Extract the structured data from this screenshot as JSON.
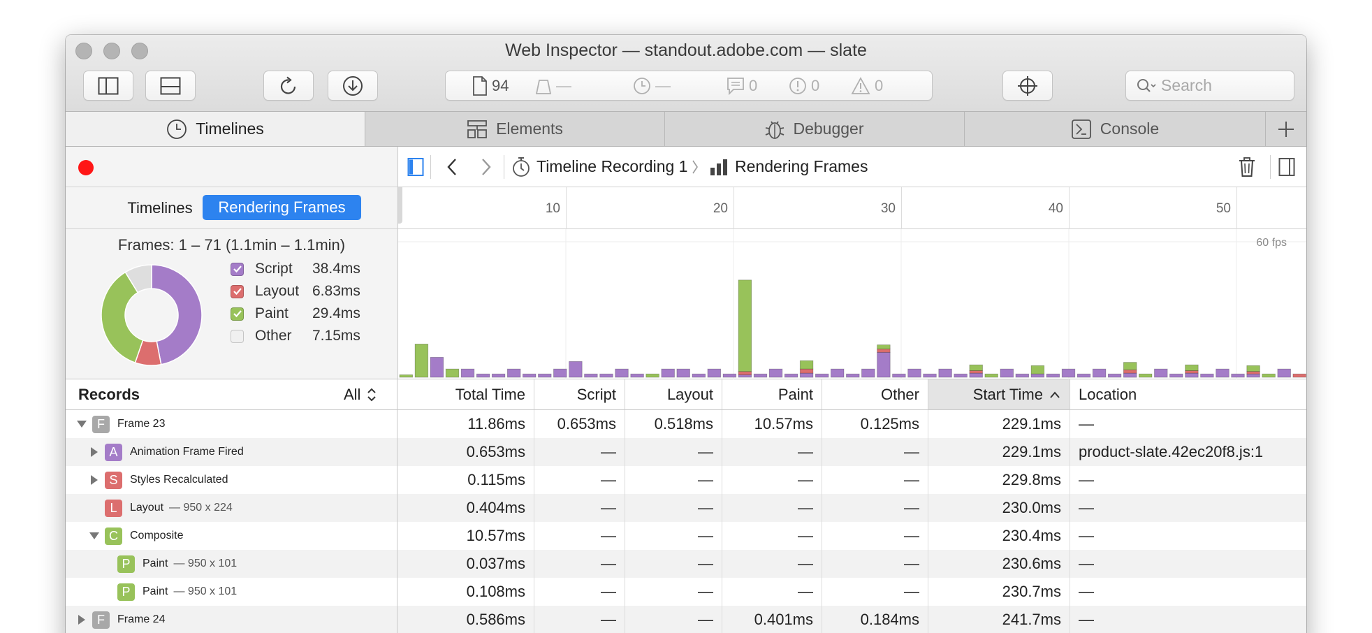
{
  "window": {
    "title": "Web Inspector — standout.adobe.com — slate"
  },
  "toolbar": {
    "resource_count": "94",
    "requests_count": "—",
    "load_time": "—",
    "logs_count": "0",
    "errors_count": "0",
    "warnings_count": "0",
    "search_placeholder": "Search"
  },
  "tabs": [
    {
      "label": "Timelines",
      "icon": "clock-icon",
      "active": true
    },
    {
      "label": "Elements",
      "icon": "elements-icon",
      "active": false
    },
    {
      "label": "Debugger",
      "icon": "bug-icon",
      "active": false
    },
    {
      "label": "Console",
      "icon": "console-icon",
      "active": false
    }
  ],
  "sidebar": {
    "mode_timelines": "Timelines",
    "mode_frames": "Rendering Frames",
    "frames_range": "Frames: 1 – 71 (1.1min – 1.1min)",
    "legend": [
      {
        "label": "Script",
        "value": "38.4ms",
        "color": "#a47cc8",
        "checked": true
      },
      {
        "label": "Layout",
        "value": "6.83ms",
        "color": "#dc6e6e",
        "checked": true
      },
      {
        "label": "Paint",
        "value": "29.4ms",
        "color": "#98c25a",
        "checked": true
      },
      {
        "label": "Other",
        "value": "7.15ms",
        "color": "#dedede",
        "checked": false
      }
    ]
  },
  "navbar": {
    "recording": "Timeline Recording 1",
    "view": "Rendering Frames"
  },
  "ruler": {
    "ticks": [
      "10",
      "20",
      "30",
      "40",
      "50"
    ],
    "fps_label": "60 fps"
  },
  "frames": [
    [
      0,
      0,
      0.3,
      0
    ],
    [
      0,
      0,
      4.0,
      0
    ],
    [
      2.4,
      0,
      0,
      0
    ],
    [
      0,
      0,
      1.0,
      0
    ],
    [
      1.0,
      0,
      0,
      0
    ],
    [
      0.4,
      0,
      0,
      0
    ],
    [
      0.4,
      0,
      0,
      0
    ],
    [
      1.0,
      0,
      0,
      0
    ],
    [
      0.4,
      0,
      0,
      0
    ],
    [
      0.4,
      0,
      0,
      0
    ],
    [
      1.0,
      0,
      0,
      0
    ],
    [
      1.9,
      0,
      0,
      0
    ],
    [
      0.4,
      0,
      0,
      0
    ],
    [
      0.4,
      0,
      0,
      0
    ],
    [
      1.0,
      0,
      0,
      0
    ],
    [
      0.4,
      0,
      0,
      0
    ],
    [
      0,
      0,
      0.4,
      0
    ],
    [
      1.0,
      0,
      0,
      0
    ],
    [
      1.0,
      0,
      0,
      0
    ],
    [
      0.4,
      0,
      0,
      0
    ],
    [
      1.0,
      0,
      0,
      0
    ],
    [
      0.4,
      0,
      0,
      0
    ],
    [
      0.3,
      0.4,
      11.0,
      0
    ],
    [
      0.4,
      0,
      0,
      0
    ],
    [
      1.0,
      0,
      0,
      0
    ],
    [
      0.4,
      0,
      0,
      0
    ],
    [
      0.5,
      0.5,
      1.0,
      0
    ],
    [
      0.4,
      0,
      0,
      0
    ],
    [
      1.0,
      0,
      0,
      0
    ],
    [
      0.4,
      0,
      0,
      0
    ],
    [
      1.0,
      0,
      0,
      0
    ],
    [
      3.0,
      0.4,
      0.5,
      0
    ],
    [
      0.4,
      0,
      0,
      0
    ],
    [
      1.0,
      0,
      0,
      0
    ],
    [
      0.4,
      0,
      0,
      0
    ],
    [
      1.0,
      0,
      0,
      0
    ],
    [
      0.4,
      0,
      0,
      0
    ],
    [
      0.5,
      0.3,
      0.7,
      0
    ],
    [
      0,
      0,
      0.4,
      0
    ],
    [
      1.0,
      0,
      0,
      0
    ],
    [
      0.4,
      0,
      0,
      0
    ],
    [
      0.4,
      0,
      1.0,
      0
    ],
    [
      0.4,
      0,
      0,
      0
    ],
    [
      1.0,
      0,
      0,
      0
    ],
    [
      0.4,
      0,
      0,
      0
    ],
    [
      1.0,
      0,
      0,
      0
    ],
    [
      0.4,
      0,
      0,
      0
    ],
    [
      0.5,
      0.4,
      0.9,
      0
    ],
    [
      0,
      0,
      0.4,
      0
    ],
    [
      1.0,
      0,
      0,
      0
    ],
    [
      0.4,
      0,
      0,
      0
    ],
    [
      0.5,
      0.3,
      0.7,
      0
    ],
    [
      0.4,
      0,
      0,
      0
    ],
    [
      1.0,
      0,
      0,
      0
    ],
    [
      0.4,
      0,
      0,
      0
    ],
    [
      0.4,
      0.3,
      0.7,
      0
    ],
    [
      0,
      0,
      0.4,
      0
    ],
    [
      1.0,
      0,
      0,
      0
    ],
    [
      0,
      0.4,
      0,
      0
    ]
  ],
  "table": {
    "records_label": "Records",
    "filter_label": "All",
    "columns": {
      "total": "Total Time",
      "script": "Script",
      "layout": "Layout",
      "paint": "Paint",
      "other": "Other",
      "start": "Start Time",
      "location": "Location"
    },
    "rows": [
      {
        "indent": 0,
        "disclosure": "open",
        "badge": "F",
        "color": "#a8a8a8",
        "name": "Frame 23",
        "sub": "",
        "total": "11.86ms",
        "script": "0.653ms",
        "layout": "0.518ms",
        "paint": "10.57ms",
        "other": "0.125ms",
        "start": "229.1ms",
        "location": "—"
      },
      {
        "indent": 1,
        "disclosure": "closed",
        "badge": "A",
        "color": "#a47cc8",
        "name": "Animation Frame Fired",
        "sub": "",
        "total": "0.653ms",
        "script": "—",
        "layout": "—",
        "paint": "—",
        "other": "—",
        "start": "229.1ms",
        "location": "product-slate.42ec20f8.js:1"
      },
      {
        "indent": 1,
        "disclosure": "closed",
        "badge": "S",
        "color": "#dc6e6e",
        "name": "Styles Recalculated",
        "sub": "",
        "total": "0.115ms",
        "script": "—",
        "layout": "—",
        "paint": "—",
        "other": "—",
        "start": "229.8ms",
        "location": "—"
      },
      {
        "indent": 1,
        "disclosure": "none",
        "badge": "L",
        "color": "#dc6e6e",
        "name": "Layout",
        "sub": "— 950 x 224",
        "total": "0.404ms",
        "script": "—",
        "layout": "—",
        "paint": "—",
        "other": "—",
        "start": "230.0ms",
        "location": "—"
      },
      {
        "indent": 1,
        "disclosure": "open",
        "badge": "C",
        "color": "#98c25a",
        "name": "Composite",
        "sub": "",
        "total": "10.57ms",
        "script": "—",
        "layout": "—",
        "paint": "—",
        "other": "—",
        "start": "230.4ms",
        "location": "—"
      },
      {
        "indent": 2,
        "disclosure": "none",
        "badge": "P",
        "color": "#98c25a",
        "name": "Paint",
        "sub": "— 950 x 101",
        "total": "0.037ms",
        "script": "—",
        "layout": "—",
        "paint": "—",
        "other": "—",
        "start": "230.6ms",
        "location": "—"
      },
      {
        "indent": 2,
        "disclosure": "none",
        "badge": "P",
        "color": "#98c25a",
        "name": "Paint",
        "sub": "— 950 x 101",
        "total": "0.108ms",
        "script": "—",
        "layout": "—",
        "paint": "—",
        "other": "—",
        "start": "230.7ms",
        "location": "—"
      },
      {
        "indent": 0,
        "disclosure": "closed",
        "badge": "F",
        "color": "#a8a8a8",
        "name": "Frame 24",
        "sub": "",
        "total": "0.586ms",
        "script": "—",
        "layout": "—",
        "paint": "0.401ms",
        "other": "0.184ms",
        "start": "241.7ms",
        "location": "—"
      }
    ]
  },
  "colors": {
    "script": "#a47cc8",
    "layout": "#dc6e6e",
    "paint": "#98c25a",
    "other": "#dedede",
    "accent": "#2d83ef",
    "record": "#ff1616"
  }
}
